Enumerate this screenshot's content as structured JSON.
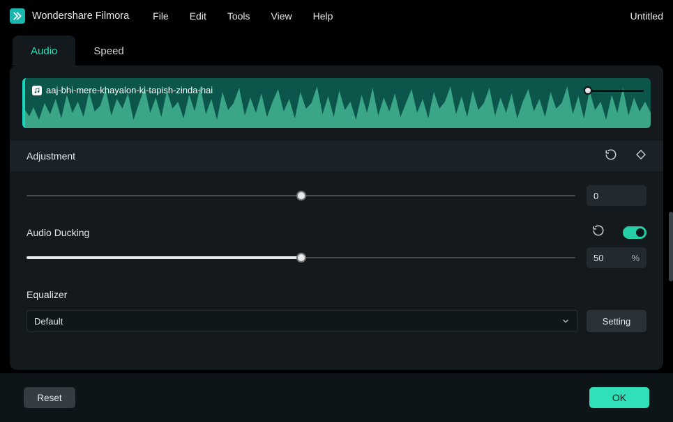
{
  "app": {
    "title": "Wondershare Filmora",
    "project": "Untitled"
  },
  "menu": {
    "file": "File",
    "edit": "Edit",
    "tools": "Tools",
    "view": "View",
    "help": "Help"
  },
  "tabs": {
    "audio": "Audio",
    "speed": "Speed"
  },
  "track": {
    "name": "aaj-bhi-mere-khayalon-ki-tapish-zinda-hai"
  },
  "section": {
    "adjustment": "Adjustment"
  },
  "pitch": {
    "value": "0",
    "slider_pct": 50
  },
  "ducking": {
    "label": "Audio Ducking",
    "value": "50",
    "unit": "%",
    "slider_pct": 50,
    "enabled": true
  },
  "equalizer": {
    "label": "Equalizer",
    "selected": "Default",
    "setting_btn": "Setting"
  },
  "footer": {
    "reset": "Reset",
    "ok": "OK"
  },
  "colors": {
    "accent": "#2fe0b9",
    "bg_panel": "#13191d"
  }
}
